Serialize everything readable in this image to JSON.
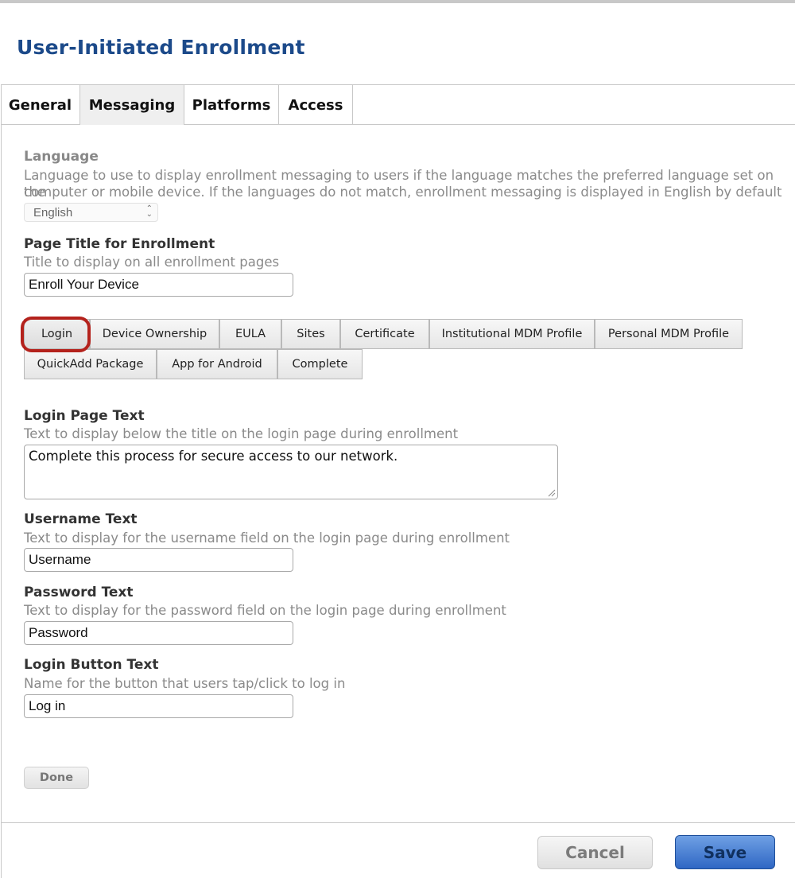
{
  "page": {
    "title": "User-Initiated Enrollment"
  },
  "main_tabs": [
    {
      "label": "General",
      "active": false
    },
    {
      "label": "Messaging",
      "active": true
    },
    {
      "label": "Platforms",
      "active": false
    },
    {
      "label": "Access",
      "active": false
    }
  ],
  "language": {
    "label": "Language",
    "description_line1": "Language to use to display enrollment messaging to users if the language matches the preferred language set on the",
    "description_line2": "computer or mobile device. If the languages do not match, enrollment messaging is displayed in English by default",
    "selected": "English"
  },
  "page_title_field": {
    "label": "Page Title for Enrollment",
    "description": "Title to display on all enrollment pages",
    "value": "Enroll Your Device"
  },
  "sub_tabs": [
    {
      "label": "Login",
      "active": true
    },
    {
      "label": "Device Ownership",
      "active": false
    },
    {
      "label": "EULA",
      "active": false
    },
    {
      "label": "Sites",
      "active": false
    },
    {
      "label": "Certificate",
      "active": false
    },
    {
      "label": "Institutional MDM Profile",
      "active": false
    },
    {
      "label": "Personal MDM Profile",
      "active": false
    },
    {
      "label": "QuickAdd Package",
      "active": false
    },
    {
      "label": "App for Android",
      "active": false
    },
    {
      "label": "Complete",
      "active": false
    }
  ],
  "login_page_text": {
    "label": "Login Page Text",
    "description": "Text to display below the title on the login page during enrollment",
    "value": "Complete this process for secure access to our network."
  },
  "username_text": {
    "label": "Username Text",
    "description": "Text to display for the username field on the login page during enrollment",
    "value": "Username"
  },
  "password_text": {
    "label": "Password Text",
    "description": "Text to display for the password field on the login page during enrollment",
    "value": "Password"
  },
  "login_button_text": {
    "label": "Login Button Text",
    "description": "Name for the button that users tap/click to log in",
    "value": "Log in"
  },
  "buttons": {
    "done": "Done",
    "cancel": "Cancel",
    "save": "Save"
  },
  "colors": {
    "title": "#1c4a8a",
    "highlight_ring": "#b4221c",
    "save_button": "#2f67c4"
  }
}
